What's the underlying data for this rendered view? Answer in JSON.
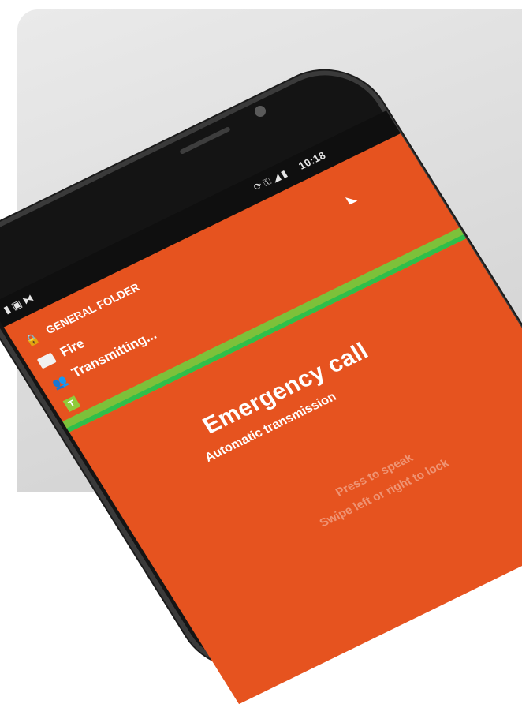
{
  "status_bar": {
    "time": "10:18",
    "icons": [
      "sync-icon",
      "key-icon",
      "signal-icon",
      "battery-icon"
    ],
    "left_icons": [
      "sd-card-icon",
      "image-icon",
      "cast-icon"
    ]
  },
  "app": {
    "folder_label": "GENERAL FOLDER",
    "group_label": "Fire",
    "status_label": "Transmitting...",
    "emergency_title": "Emergency call",
    "emergency_subtitle": "Automatic transmission",
    "hint_line1": "Press to speak",
    "hint_line2": "Swipe left or right to lock"
  },
  "colors": {
    "app_bg": "#e6531f",
    "status_bar_bg": "#0f0f0f",
    "band_green": "#7cc13a"
  }
}
